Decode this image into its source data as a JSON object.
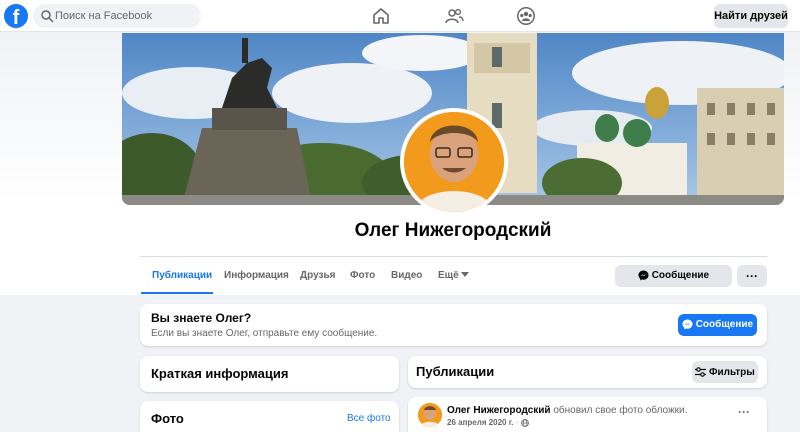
{
  "topbar": {
    "search_placeholder": "Поиск на Facebook",
    "find_friends_label": "Найти друзей",
    "logo_letter": "f"
  },
  "profile": {
    "name": "Олег Нижегородский"
  },
  "tabs": [
    {
      "label": "Публикации",
      "active": true
    },
    {
      "label": "Информация"
    },
    {
      "label": "Друзья"
    },
    {
      "label": "Фото"
    },
    {
      "label": "Видео"
    },
    {
      "label": "Ещё"
    }
  ],
  "actions": {
    "message_label": "Сообщение",
    "more_label": "···"
  },
  "know_card": {
    "title": "Вы знаете Олег?",
    "subtitle": "Если вы знаете Олег, отправьте ему сообщение.",
    "button_label": "Сообщение"
  },
  "intro_card": {
    "title": "Краткая информация"
  },
  "photos_card": {
    "title": "Фото",
    "all_link": "Все фото"
  },
  "posts_card": {
    "title": "Публикации",
    "filters_label": "Фильтры"
  },
  "post": {
    "author": "Олег Нижегородский",
    "action": "обновил свое фото обложки.",
    "date": "26 апреля 2020 г.",
    "separator": "·",
    "more_label": "···"
  },
  "colors": {
    "brand": "#1877f2",
    "secondary_text": "#65676b",
    "button_grey": "#e4e6eb",
    "page_bg": "#f0f2f5"
  },
  "icons": [
    "facebook-logo",
    "search-icon",
    "home-icon",
    "friends-icon",
    "groups-icon",
    "messenger-icon",
    "caret-down-icon",
    "filters-icon",
    "globe-icon"
  ]
}
